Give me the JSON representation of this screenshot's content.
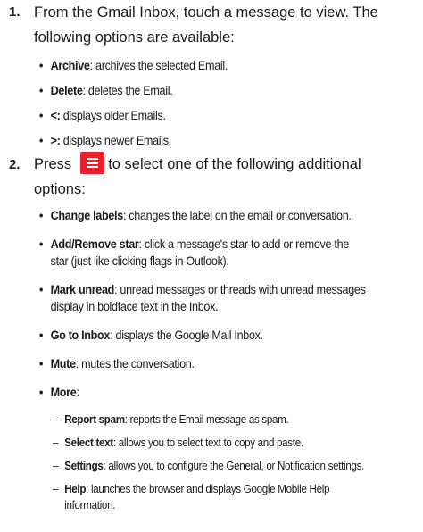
{
  "step1": {
    "number": "1.",
    "line1": "From the Gmail Inbox, touch a message to view. The",
    "line2": "following options are available:",
    "bullets": [
      {
        "term": "Archive",
        "text": ": archives the selected Email."
      },
      {
        "term": "Delete",
        "text": ": deletes the Email."
      },
      {
        "term": "<:",
        "text": " displays older Emails."
      },
      {
        "term": ">:",
        "text": " displays newer Emails."
      }
    ]
  },
  "step2": {
    "number": "2.",
    "prefix": "Press",
    "icon": "menu-icon",
    "suffix": "to select one of the following additional",
    "line2": "options:",
    "bullets": [
      {
        "term": "Change labels",
        "text": ": changes the label on the email or conversation."
      },
      {
        "term": "Add/Remove star",
        "text": ": click a message's star to add or remove the",
        "wrap": "star (just like clicking flags in Outlook)."
      },
      {
        "term": "Mark unread",
        "text": ": unread messages or threads with unread messages",
        "wrap": "display in boldface text in the Inbox."
      },
      {
        "term": "Go to Inbox",
        "text": ": displays the Google Mail Inbox."
      },
      {
        "term": "Mute",
        "text": ": mutes the conversation."
      },
      {
        "term": "More",
        "text": ":"
      }
    ],
    "sub_items": [
      {
        "term": "Report spam",
        "text": ": reports the Email message as spam."
      },
      {
        "term": "Select text",
        "text": ": allows you to select text to copy and paste."
      },
      {
        "term": "Settings",
        "text": ": allows you to configure the General, or Notification settings."
      },
      {
        "term": "Help",
        "text": ": launches the browser and displays Google Mobile Help",
        "wrap": "information."
      }
    ]
  },
  "colors": {
    "icon_bg": "#e8212e",
    "text": "#1a1a1a"
  }
}
